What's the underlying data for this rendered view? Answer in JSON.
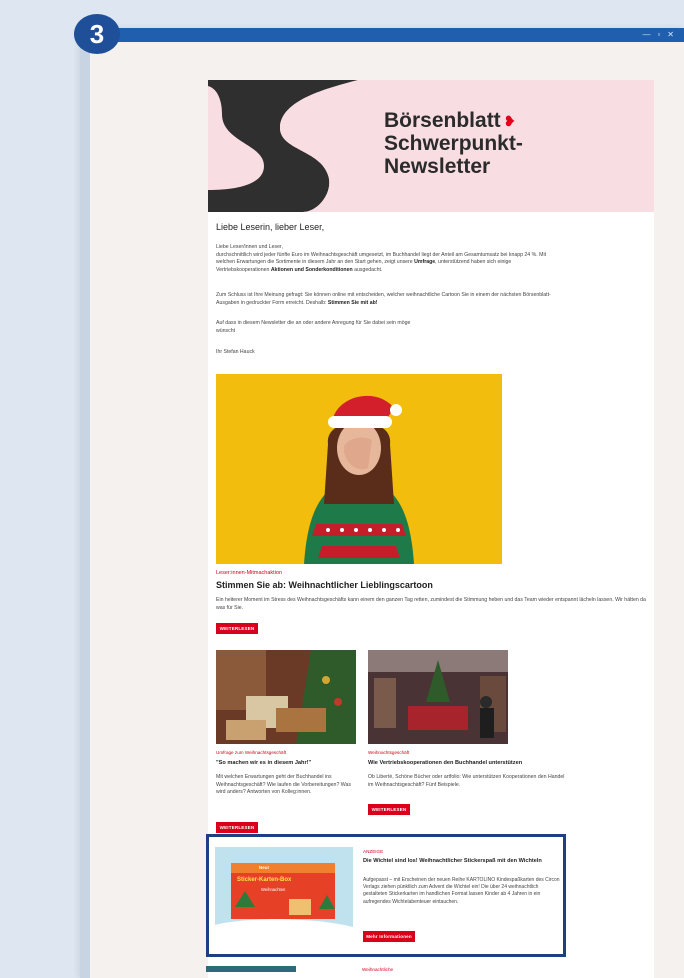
{
  "step": "3",
  "window_controls": [
    "—",
    "▫",
    "✕"
  ],
  "header": {
    "brand_line1": "Börsenblatt",
    "brand_line2": "Schwerpunkt-",
    "brand_line3": "Newsletter"
  },
  "greeting": "Liebe Leserin, lieber Leser,",
  "intro": {
    "p1_a": "Liebe Leser/innen und Leser,",
    "p1_b": "durchschnittlich wird jeder fünfte Euro im Weihnachtsgeschäft umgesetzt, im Buchhandel liegt der Anteil am Gesamtumsatz bei knapp 24 %. Mit welchen Erwartungen die Sortimente in diesem Jahr an den Start gehen, zeigt unsere",
    "p1_bold1": "Umfrage",
    "p1_c": ", unterstützend haben sich einige Vertriebskooperationen",
    "p1_bold2": "Aktionen und Sonderkonditionen",
    "p1_d": "ausgedacht.",
    "p2": "Zum Schluss ist Ihre Meinung gefragt: Sie können online mit entscheiden, welcher weihnachtliche Cartoon Sie in einem der nächsten Börsenblatt-Ausgaben in gedruckter Form erreicht. Deshalb:",
    "p2_bold": "Stimmen Sie mit ab!",
    "p3": "Auf dass in diesem Newsletter die an oder andere Anregung für Sie dabei sein möge",
    "p3_b": "wünscht",
    "sign": "Ihr Stefan Hauck"
  },
  "feature": {
    "kicker": "Leser:innen-Mitmachaktion",
    "title": "Stimmen Sie ab: Weihnachtlicher Lieblingscartoon",
    "text": "Ein heiterer Moment im Stress des Weihnachtsgeschäfts kann einem den ganzen Tag retten, zumindest die Stimmung heben und das Team wieder entspannt lächeln lassen. Wir hätten da was für Sie.",
    "button": "WEITERLESEN"
  },
  "left_article": {
    "kicker": "Umfrage zum Weihnachtsgeschäft",
    "title": "\"So machen wir es in diesem Jahr!\"",
    "text": "Mit welchen Erwartungen geht der Buchhandel ins Weihnachtsgeschäft? Wie laufen die Vorbereitungen? Was wird anders? Antworten von Kolleg:innen.",
    "button": "WEITERLESEN"
  },
  "right_article": {
    "kicker": "Weihnachtsgeschäft",
    "title": "Wie Vertriebskooperationen den Buchhandel unterstützen",
    "text": "Ob Libertè, Schöne Bücher oder artfolio: Wie unterstützen Kooperationen den Handel im Weihnachtsgeschäft? Fünf Beispiele.",
    "button": "WEITERLESEN"
  },
  "ad": {
    "kicker": "ANZEIGE",
    "title": "Die Wichtel sind los! Weihnachtlicher Stickerspaß mit den Wichteln",
    "text": "Aufgepasst – mit Erscheinen der neuen Reihe KARTOLINO Kindespaßkarten des Circon Verlags ziehen pünktlich zum Advent die Wichtel ein! Die über 24 weihnachtlich gestalteten Stickerkarten im handlichen Format lassen Kinder ab 4 Jahren in ein aufregendes Wichtelabenteuer eintauchen.",
    "button": "Mehr Informationen",
    "box_line1": "Neu!",
    "box_line2": "Sticker-Karten-Box",
    "box_line3": "Weihnachten"
  },
  "bottom_kicker": "Weihnachtliche",
  "colors": {
    "accent_red": "#d9001b",
    "titlebar_blue": "#1f5fae",
    "highlight_border": "#1f3f84",
    "hero_pink": "#f8dde2"
  }
}
